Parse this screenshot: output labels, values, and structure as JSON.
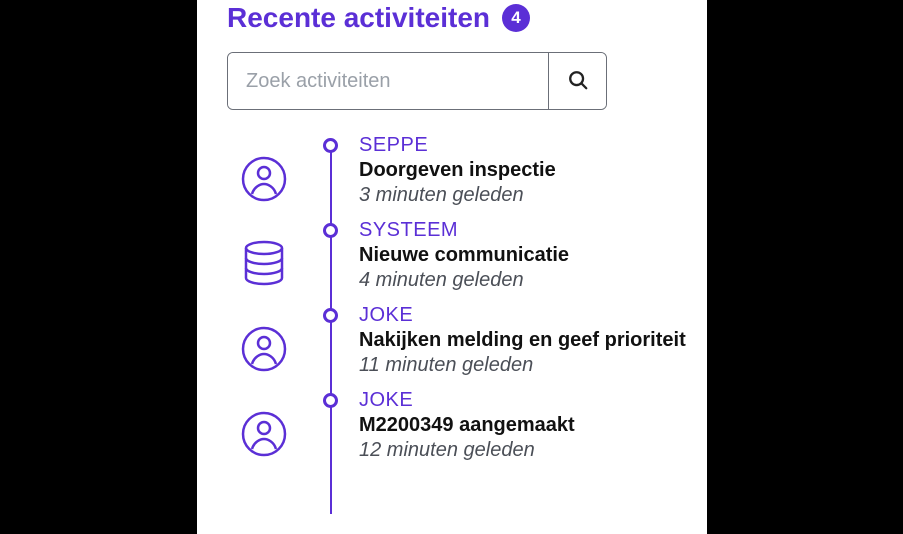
{
  "header": {
    "title": "Recente activiteiten",
    "count": "4"
  },
  "search": {
    "placeholder": "Zoek activiteiten"
  },
  "colors": {
    "accent": "#5b2fd6"
  },
  "activities": [
    {
      "user": "SEPPE",
      "icon": "person",
      "description": "Doorgeven inspectie",
      "time": "3 minuten geleden"
    },
    {
      "user": "SYSTEEM",
      "icon": "db",
      "description": "Nieuwe communicatie",
      "time": "4 minuten geleden"
    },
    {
      "user": "JOKE",
      "icon": "person",
      "description": "Nakijken melding en geef prioriteit",
      "time": "11 minuten geleden"
    },
    {
      "user": "JOKE",
      "icon": "person",
      "description": "M2200349 aangemaakt",
      "time": "12 minuten geleden"
    }
  ]
}
